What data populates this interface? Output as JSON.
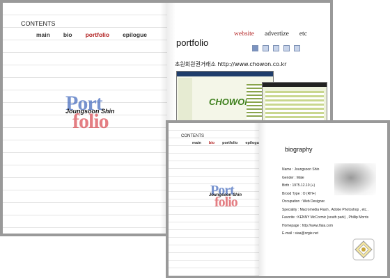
{
  "book1": {
    "contents_label": "CONTENTS",
    "nav": [
      "main",
      "bio",
      "portfolio",
      "epilogue"
    ],
    "active_nav": "portfolio",
    "logo": {
      "top": "Port",
      "bottom": "folio",
      "name": "Joungsoon Shin"
    },
    "right_nav": [
      "website",
      "advertize",
      "etc"
    ],
    "active_right_nav": "website",
    "page_title": "portfolio",
    "site_line": "초원회원권거래소 http://www.chowon.co.kr",
    "thumb_logo": "CHOWON"
  },
  "book2": {
    "contents_label": "CONTENTS",
    "nav": [
      "main",
      "bio",
      "portfolio",
      "epilogue"
    ],
    "active_nav": "bio",
    "logo": {
      "top": "Port",
      "bottom": "folio",
      "name": "Joungsoon Shin"
    },
    "page_title": "biography",
    "bio_lines": [
      "Name : Joungsoon Shin",
      "Gender : Male",
      "Birth : 1975.12.10 (+)",
      "Brood Type : O (RH+)",
      "Occupation : Web Designer.",
      "Speciality : Macromedia Flash , Adobe Photoshop , etc..",
      "Favorite : KENNY McCormic (south park) , Phillip Morris",
      "Homepage : http://www.flaia.com",
      "E-mail : siaa@orgie.net"
    ]
  },
  "colors": {
    "accent_red": "#b22222",
    "logo_blue": "#4a6fc0",
    "logo_red": "#d9484f"
  }
}
